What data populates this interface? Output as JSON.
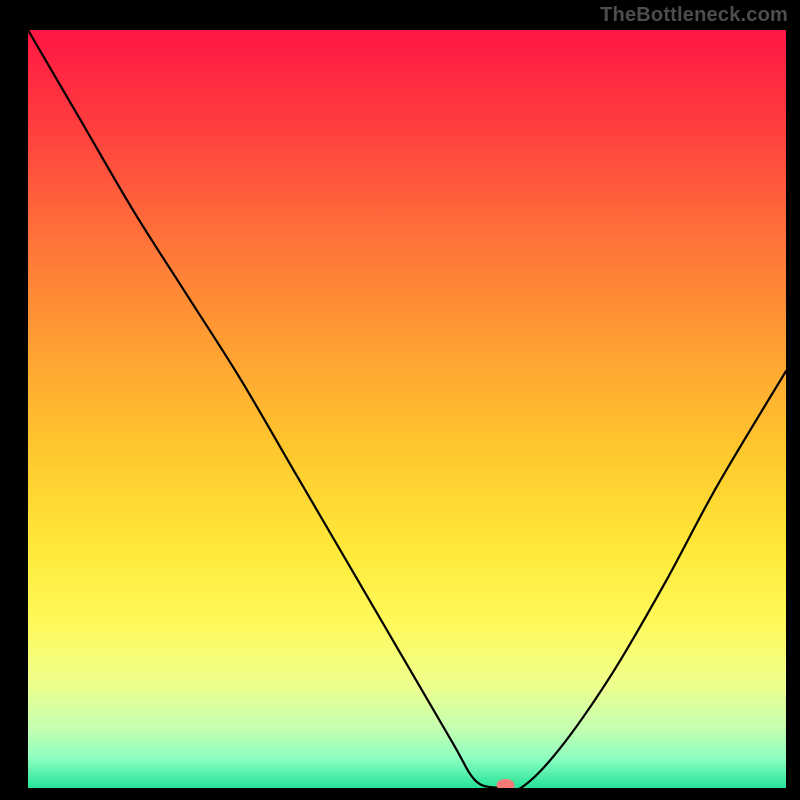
{
  "watermark": "TheBottleneck.com",
  "chart_data": {
    "type": "line",
    "title": "",
    "xlabel": "",
    "ylabel": "",
    "xlim": [
      0,
      100
    ],
    "ylim": [
      0,
      100
    ],
    "grid": false,
    "background": "red-to-green vertical gradient",
    "series": [
      {
        "name": "curve",
        "x": [
          0,
          7,
          14,
          21,
          28,
          35,
          42,
          49,
          56,
          59,
          62,
          65,
          70,
          77,
          84,
          91,
          100
        ],
        "values": [
          100,
          88,
          76,
          65,
          54,
          42,
          30,
          18,
          6,
          1,
          0,
          0,
          5,
          15,
          27,
          40,
          55
        ]
      }
    ],
    "marker": {
      "x": 63,
      "y": 0,
      "color": "#f67b76"
    },
    "gradient_stops": [
      {
        "offset": 0,
        "color": "#ff1744"
      },
      {
        "offset": 12,
        "color": "#ff3b3f"
      },
      {
        "offset": 25,
        "color": "#ff6a3a"
      },
      {
        "offset": 40,
        "color": "#ff9a33"
      },
      {
        "offset": 55,
        "color": "#ffc62e"
      },
      {
        "offset": 68,
        "color": "#ffe838"
      },
      {
        "offset": 78,
        "color": "#fff95a"
      },
      {
        "offset": 86,
        "color": "#f0ff8a"
      },
      {
        "offset": 92,
        "color": "#c6ffb0"
      },
      {
        "offset": 96,
        "color": "#8effc0"
      },
      {
        "offset": 100,
        "color": "#25e49a"
      }
    ]
  }
}
